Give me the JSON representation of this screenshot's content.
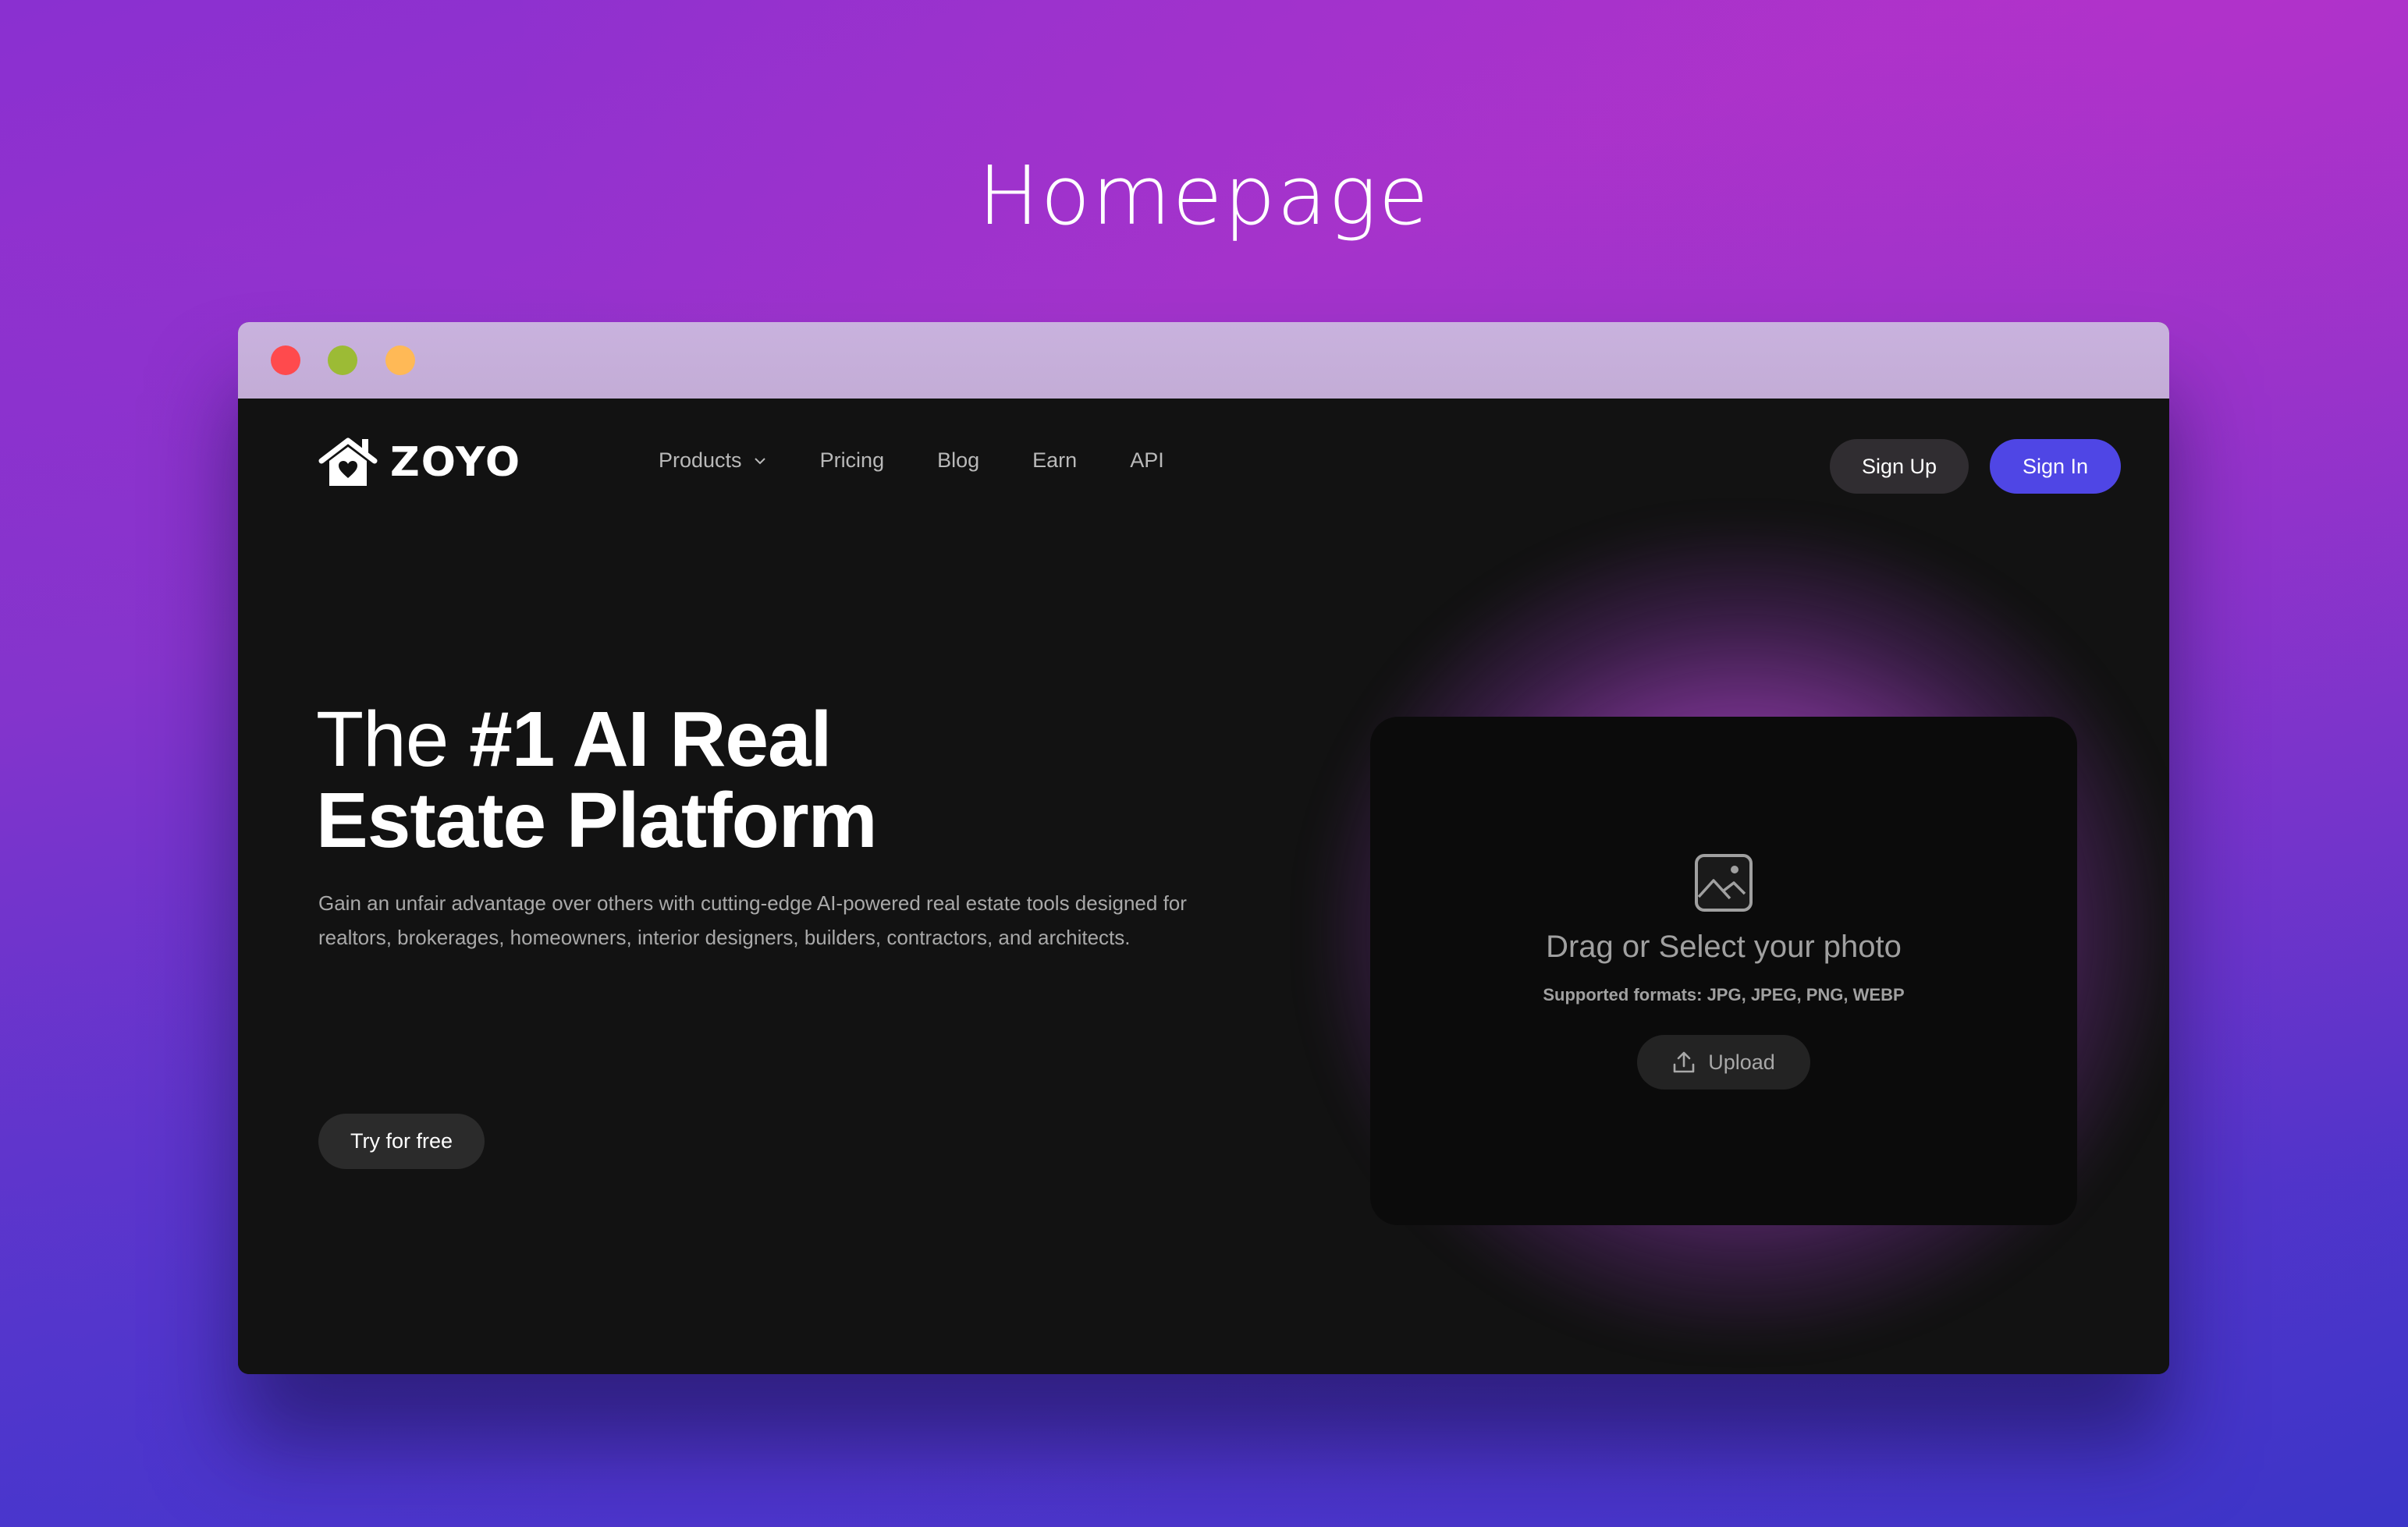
{
  "page": {
    "heading": "Homepage"
  },
  "window": {
    "controls": [
      "close",
      "minimize",
      "maximize"
    ]
  },
  "nav": {
    "brand": "ZOYO",
    "links": [
      {
        "label": "Products",
        "has_dropdown": true
      },
      {
        "label": "Pricing"
      },
      {
        "label": "Blog"
      },
      {
        "label": "Earn"
      },
      {
        "label": "API"
      }
    ],
    "sign_up": "Sign Up",
    "sign_in": "Sign In"
  },
  "hero": {
    "title_light": "The ",
    "title_bold_1": "#1 AI Real",
    "title_bold_2": "Estate Platform",
    "description": "Gain an unfair advantage over others with cutting-edge AI-powered real estate tools designed for realtors, brokerages, homeowners, interior designers, builders, contractors, and architects.",
    "cta": "Try for free"
  },
  "upload": {
    "title": "Drag or Select your photo",
    "formats": "Supported formats: JPG, JPEG, PNG, WEBP",
    "button": "Upload"
  },
  "colors": {
    "accent": "#4f46e5",
    "close": "#ff4a4d",
    "minimize": "#9cbb35",
    "maximize": "#ffb956",
    "glow": "#a040c0"
  }
}
